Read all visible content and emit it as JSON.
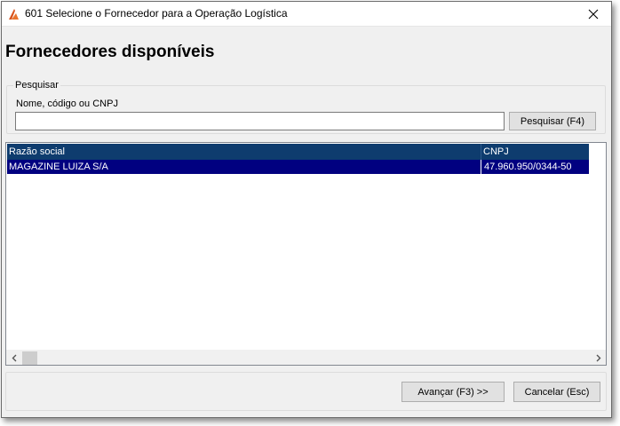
{
  "window": {
    "title": "601 Selecione o Fornecedor para a Operação Logística"
  },
  "heading": "Fornecedores disponíveis",
  "search": {
    "group_label": "Pesquisar",
    "field_label": "Nome, código ou CNPJ",
    "value": "",
    "placeholder": "",
    "button_label": "Pesquisar (F4)"
  },
  "grid": {
    "columns": [
      "Razão social",
      "CNPJ"
    ],
    "rows": [
      {
        "razao_social": "MAGAZINE LUIZA S/A",
        "cnpj": "47.960.950/0344-50",
        "selected": true
      }
    ]
  },
  "footer": {
    "next_label": "Avançar (F3) >>",
    "cancel_label": "Cancelar (Esc)"
  },
  "icons": {
    "app": "app-logo-icon",
    "close": "close-icon",
    "scroll_left": "chevron-left-icon",
    "scroll_right": "chevron-right-icon"
  },
  "colors": {
    "header_bg": "#0e3c6e",
    "selected_row_bg": "#010080",
    "window_bg": "#f0f0f0",
    "app_icon": "#d9531e"
  }
}
